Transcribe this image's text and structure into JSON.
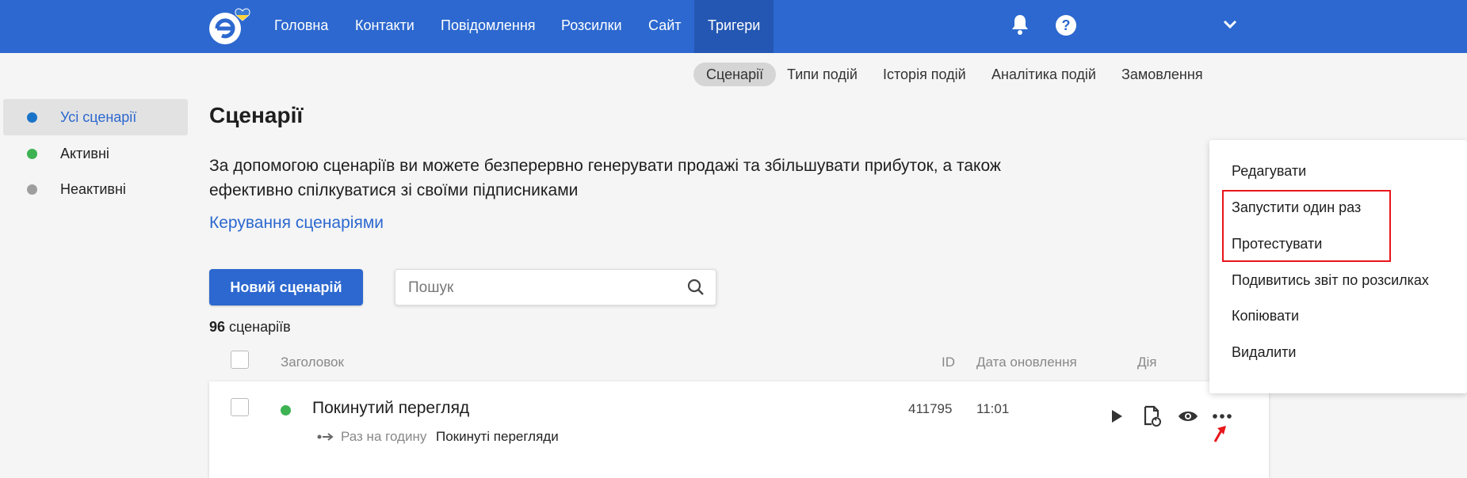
{
  "nav": {
    "items": [
      "Головна",
      "Контакти",
      "Повідомлення",
      "Розсилки",
      "Сайт",
      "Тригери"
    ],
    "active": "Тригери"
  },
  "subnav": {
    "items": [
      "Сценарії",
      "Типи подій",
      "Історія подій",
      "Аналітика подій",
      "Замовлення"
    ],
    "active": "Сценарії"
  },
  "sidebar": {
    "items": [
      {
        "label": "Усі сценарії",
        "dot_color": "#1a73c8"
      },
      {
        "label": "Активні",
        "dot_color": "#3cb253"
      },
      {
        "label": "Неактивні",
        "dot_color": "#9e9e9e"
      }
    ]
  },
  "main": {
    "title": "Сценарії",
    "description": "За допомогою сценаріїв ви можете безперервно генерувати продажі та збільшувати прибуток, а також ефективно спілкуватися зі своїми підписниками",
    "manage_link": "Керування сценаріями",
    "new_button": "Новий сценарій",
    "search_placeholder": "Пошук",
    "count_number": "96",
    "count_label": "сценаріїв"
  },
  "table": {
    "headers": {
      "title": "Заголовок",
      "id": "ID",
      "date": "Дата оновлення",
      "action": "Дія"
    },
    "rows": [
      {
        "title": "Покинутий перегляд",
        "status_color": "#3cb253",
        "schedule": "Раз на годину",
        "event": "Покинуті перегляди",
        "id": "411795",
        "updated": "11:01"
      }
    ]
  },
  "menu": {
    "items": [
      "Редагувати",
      "Запустити один раз",
      "Протестувати",
      "Подивитись звіт по розсилках",
      "Копіювати",
      "Видалити"
    ]
  },
  "colors": {
    "brand": "#2c68cf",
    "annotation": "#e8161b"
  }
}
